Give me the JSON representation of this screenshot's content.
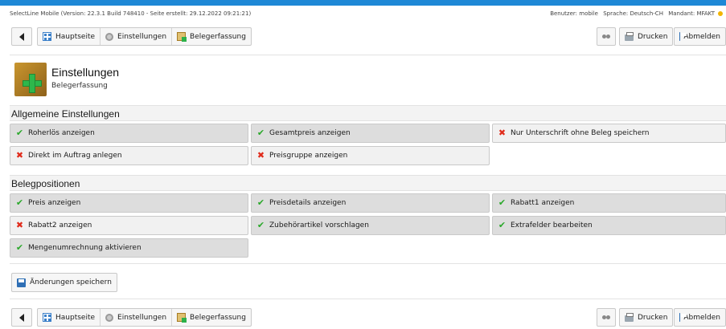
{
  "info": {
    "app": "SelectLine Mobile (Version: 22.3.1 Build 748410 - Seite erstellt: 29.12.2022 09:21:21)",
    "user": "Benutzer: mobile",
    "language": "Sprache: Deutsch-CH",
    "mandant": "Mandant: MFAKT"
  },
  "toolbar": {
    "home": "Hauptseite",
    "settings": "Einstellungen",
    "order": "Belegerfassung",
    "print": "Drucken",
    "logout": "Abmelden"
  },
  "page": {
    "title": "Einstellungen",
    "subtitle": "Belegerfassung"
  },
  "sections": {
    "general": {
      "title": "Allgemeine Einstellungen",
      "options": [
        {
          "label": "Roherlös anzeigen",
          "enabled": true
        },
        {
          "label": "Gesamtpreis anzeigen",
          "enabled": true
        },
        {
          "label": "Nur Unterschrift ohne Beleg speichern",
          "enabled": false
        },
        {
          "label": "Direkt im Auftrag anlegen",
          "enabled": false
        },
        {
          "label": "Preisgruppe anzeigen",
          "enabled": false
        }
      ]
    },
    "positions": {
      "title": "Belegpositionen",
      "options": [
        {
          "label": "Preis anzeigen",
          "enabled": true
        },
        {
          "label": "Preisdetails anzeigen",
          "enabled": true
        },
        {
          "label": "Rabatt1 anzeigen",
          "enabled": true
        },
        {
          "label": "Rabatt2 anzeigen",
          "enabled": false
        },
        {
          "label": "Zubehörartikel vorschlagen",
          "enabled": true
        },
        {
          "label": "Extrafelder bearbeiten",
          "enabled": true
        },
        {
          "label": "Mengenumrechnung aktivieren",
          "enabled": true
        }
      ]
    }
  },
  "actions": {
    "save": "Änderungen speichern"
  },
  "colors": {
    "accent": "#1e88d6",
    "check": "#2aa82a",
    "cross": "#e02b1b"
  }
}
